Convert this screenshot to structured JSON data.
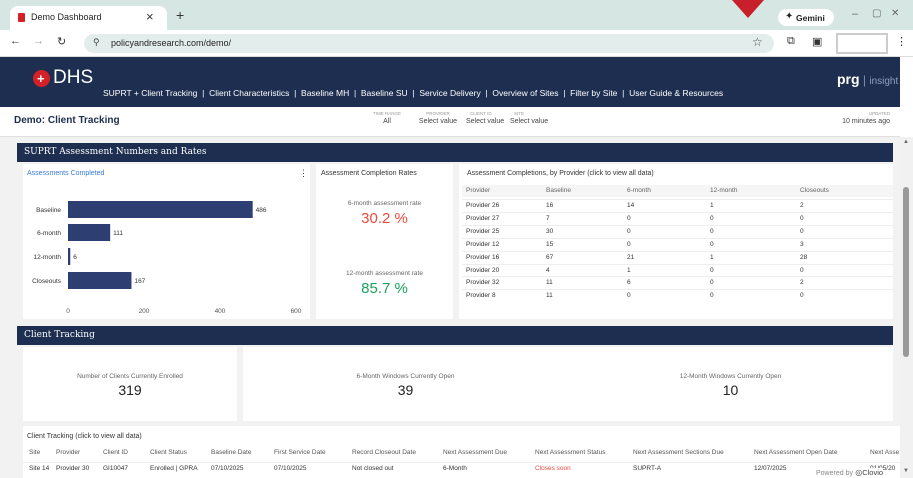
{
  "browser": {
    "tab_title": "Demo Dashboard",
    "tab_close": "×",
    "new_tab": "+",
    "url": "policyandresearch.com/demo/",
    "gemini_label": "Gemini",
    "minimize": "–",
    "restore": "▢",
    "close": "✕"
  },
  "header": {
    "logo": "DHS",
    "nav": [
      "SUPRT + Client Tracking",
      "Client Characteristics",
      "Baseline MH",
      "Baseline SU",
      "Service Delivery",
      "Overview of Sites",
      "Filter by Site",
      "User Guide & Resources"
    ],
    "brand_bold": "prg",
    "brand_light": "insight"
  },
  "subheader": {
    "title": "Demo: Client Tracking",
    "filters": [
      {
        "label": "TIME RANGE",
        "value": "All"
      },
      {
        "label": "PROVIDER",
        "value": "Select value"
      },
      {
        "label": "CLIENT ID",
        "value": "Select value"
      },
      {
        "label": "SITE",
        "value": "Select value"
      }
    ],
    "updated_label": "UPDATED",
    "updated_value": "10 minutes ago"
  },
  "sections": {
    "suprt": "SUPRT Assessment Numbers and Rates",
    "tracking": "Client Tracking"
  },
  "chart_data": {
    "type": "bar",
    "orientation": "horizontal",
    "title": "Assessments Completed",
    "categories": [
      "Baseline",
      "6-month",
      "12-month",
      "Closeouts"
    ],
    "values": [
      486,
      111,
      6,
      167
    ],
    "xticks": [
      "0",
      "200",
      "400",
      "600"
    ],
    "xlim": [
      0,
      600
    ],
    "color": "#2c3e72"
  },
  "rates": {
    "title": "Assessment Completion Rates",
    "six_label": "6-month assessment rate",
    "six_value": "30.2 %",
    "six_color": "#e84c3d",
    "twelve_label": "12-month assessment rate",
    "twelve_value": "85.7 %",
    "twelve_color": "#1aa260"
  },
  "provider_table": {
    "title": "Assessment Completions, by Provider (click to view all data)",
    "headers": [
      "Provider",
      "Baseline",
      "6-month",
      "12-month",
      "Closeouts"
    ],
    "rows": [
      [
        "Provider 26",
        "16",
        "14",
        "1",
        "2"
      ],
      [
        "Provider 27",
        "7",
        "0",
        "0",
        "0"
      ],
      [
        "Provider 25",
        "30",
        "0",
        "0",
        "0"
      ],
      [
        "Provider 12",
        "15",
        "0",
        "0",
        "3"
      ],
      [
        "Provider 16",
        "67",
        "21",
        "1",
        "28"
      ],
      [
        "Provider 20",
        "4",
        "1",
        "0",
        "0"
      ],
      [
        "Provider 32",
        "11",
        "6",
        "0",
        "2"
      ],
      [
        "Provider 8",
        "11",
        "0",
        "0",
        "0"
      ]
    ]
  },
  "kpis": [
    {
      "label": "Number of Clients Currently Enrolled",
      "value": "319"
    },
    {
      "label": "6-Month Windows Currently Open",
      "value": "39"
    },
    {
      "label": "12-Month Windows Currently Open",
      "value": "10"
    }
  ],
  "tracking_table": {
    "title": "Client Tracking (click to view all data)",
    "headers": [
      "Site",
      "Provider",
      "Client ID",
      "Client Status",
      "Baseline Date",
      "First Service Date",
      "Record Closeout Date",
      "Next Assessment Due",
      "Next Assessment Status",
      "Next Assessment Sections Due",
      "Next Assessment Open Date",
      "Next Asse"
    ],
    "row": [
      "Site 14",
      "Provider 30",
      "GI10047",
      "Enrolled | GPRA",
      "07/10/2025",
      "07/10/2025",
      "Not closed out",
      "6-Month",
      "Closes soon",
      "SUPRT-A",
      "12/07/2025",
      "01/05/20"
    ],
    "status_color": "#e84c3d"
  },
  "footer": {
    "powered_by": "Powered by",
    "brand": "Clovio"
  }
}
